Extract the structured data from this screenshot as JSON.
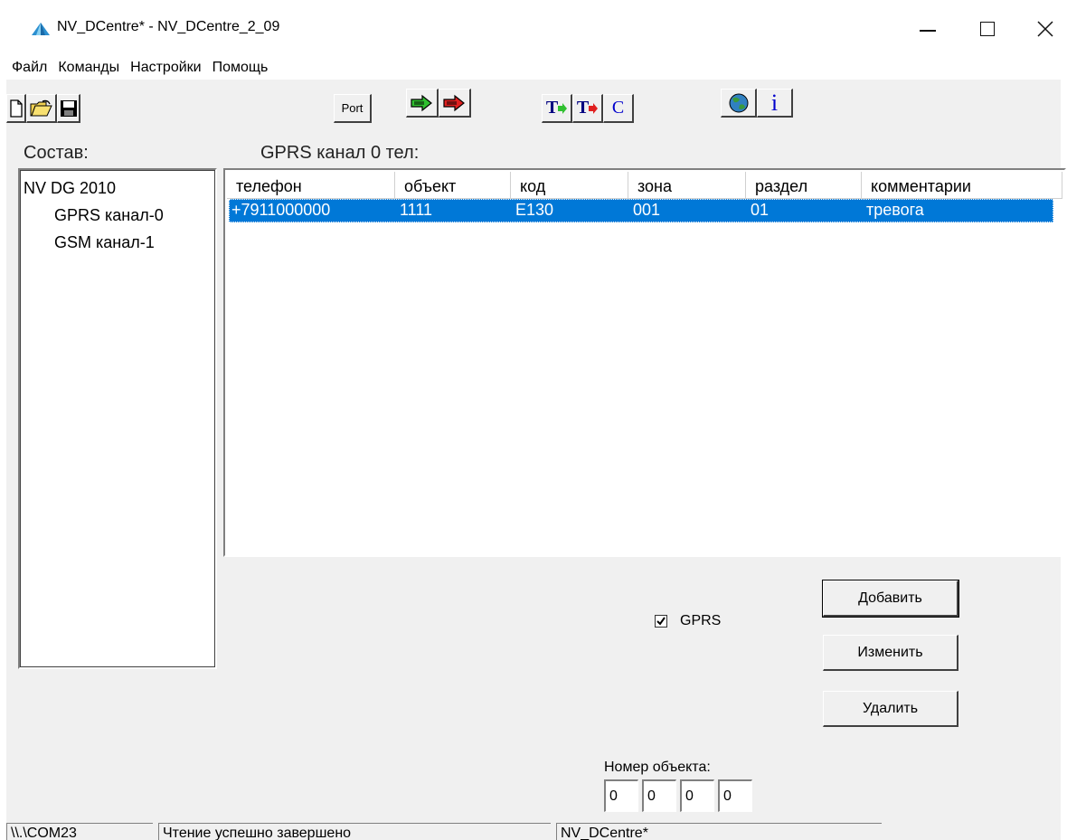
{
  "window": {
    "title": "NV_DCentre* - NV_DCentre_2_09",
    "app_icon": "pyramid-icon",
    "controls": [
      "minimize",
      "maximize",
      "close"
    ]
  },
  "menu": {
    "items": [
      "Файл",
      "Команды",
      "Настройки",
      "Помощь"
    ]
  },
  "toolbar": {
    "new_icon": "new-document-icon",
    "open_icon": "open-folder-icon",
    "save_icon": "floppy-disk-icon",
    "port_label": "Port",
    "write_icon": "arrow-right-green-icon",
    "read_icon": "arrow-right-red-icon",
    "t_write_label": "T",
    "t_read_label": "T",
    "c_label": "C",
    "globe_icon": "globe-icon",
    "info_label": "i"
  },
  "labels": {
    "sostav": "Состав:",
    "channel": "GPRS канал 0 тел:"
  },
  "tree": {
    "root": "NV DG 2010",
    "children": [
      "GPRS канал-0",
      "GSM канал-1"
    ]
  },
  "table": {
    "columns": [
      "телефон",
      "объект",
      "код",
      "зона",
      "раздел",
      "комментарии"
    ],
    "rows": [
      [
        "+7911000000",
        "1111",
        "E130",
        "001",
        "01",
        "тревога"
      ]
    ],
    "selected_row": 0
  },
  "form": {
    "gprs_checkbox_label": "GPRS",
    "gprs_checked": true,
    "add_button": "Добавить",
    "edit_button": "Изменить",
    "delete_button": "Удалить",
    "object_number_label": "Номер объекта:",
    "object_number_fields": [
      "0",
      "0",
      "0",
      "0"
    ]
  },
  "statusbar": {
    "port": "\\\\.\\COM23",
    "message": "Чтение успешно завершено",
    "app": "NV_DCentre*"
  },
  "colors": {
    "selection": "#0078d7",
    "window_bg": "#f0f0f0"
  }
}
